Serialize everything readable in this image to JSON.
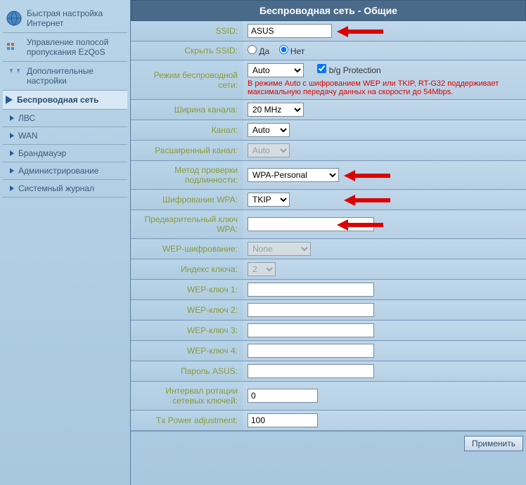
{
  "sidebar": {
    "items": [
      {
        "label": "Быстрая настройка Интернет"
      },
      {
        "label": "Управление полосой пропускания EzQoS"
      },
      {
        "label": "Дополнительные настройки"
      },
      {
        "label": "Беспроводная сеть"
      },
      {
        "label": "ЛВС"
      },
      {
        "label": "WAN"
      },
      {
        "label": "Брандмауэр"
      },
      {
        "label": "Администрирование"
      },
      {
        "label": "Системный журнал"
      }
    ]
  },
  "page": {
    "title": "Беспроводная сеть - Общие"
  },
  "form": {
    "ssid_label": "SSID:",
    "ssid_value": "ASUS",
    "hide_ssid_label": "Скрыть SSID:",
    "yes": "Да",
    "no": "Нет",
    "hide_ssid_value": "Нет",
    "mode_label": "Режим беспроводной сети:",
    "mode_value": "Auto",
    "bg_protection_label": "b/g Protection",
    "bg_protection_checked": true,
    "mode_warning": "В режиме Auto с шифрованием WEP или TKIP, RT-G32 поддерживает максимальную передачу данных на скорости до 54Mbps.",
    "width_label": "Ширина канала:",
    "width_value": "20 MHz",
    "channel_label": "Канал:",
    "channel_value": "Auto",
    "ext_channel_label": "Расширенный канал:",
    "ext_channel_value": "Auto",
    "auth_label": "Метод проверки подлинности:",
    "auth_value": "WPA-Personal",
    "wpa_enc_label": "Шифрование WPA:",
    "wpa_enc_value": "TKIP",
    "wpa_key_label": "Предварительный ключ WPA:",
    "wpa_key_value": "",
    "wep_enc_label": "WEP-шифрование:",
    "wep_enc_value": "None",
    "key_index_label": "Индекс ключа:",
    "key_index_value": "2",
    "wep1_label": "WEP-ключ 1:",
    "wep2_label": "WEP-ключ 2:",
    "wep3_label": "WEP-ключ 3:",
    "wep4_label": "WEP-ключ 4:",
    "asus_pass_label": "Пароль ASUS:",
    "rotation_label": "Интервал ротации сетевых ключей:",
    "rotation_value": "0",
    "tx_power_label": "Tx Power adjustment:",
    "tx_power_value": "100"
  },
  "footer": {
    "apply_label": "Применить"
  }
}
